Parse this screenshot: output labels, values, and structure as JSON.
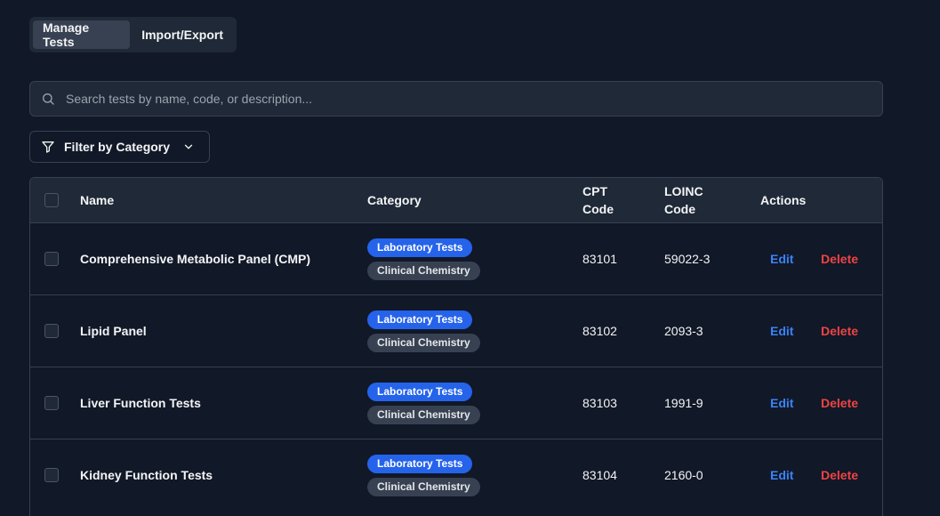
{
  "tabs": [
    {
      "label": "Manage Tests",
      "active": true
    },
    {
      "label": "Import/Export",
      "active": false
    }
  ],
  "search": {
    "placeholder": "Search tests by name, code, or description...",
    "icon": "search-icon"
  },
  "filter": {
    "label": "Filter by Category",
    "icon": "filter-icon"
  },
  "table": {
    "headers": {
      "name": "Name",
      "category": "Category",
      "cpt_line1": "CPT",
      "cpt_line2": "Code",
      "loinc_line1": "LOINC",
      "loinc_line2": "Code",
      "actions": "Actions"
    },
    "rows": [
      {
        "name": "Comprehensive Metabolic Panel (CMP)",
        "category": "Laboratory Tests",
        "subcategory": "Clinical Chemistry",
        "cpt": "83101",
        "loinc": "59022-3",
        "edit": "Edit",
        "delete": "Delete"
      },
      {
        "name": "Lipid Panel",
        "category": "Laboratory Tests",
        "subcategory": "Clinical Chemistry",
        "cpt": "83102",
        "loinc": "2093-3",
        "edit": "Edit",
        "delete": "Delete"
      },
      {
        "name": "Liver Function Tests",
        "category": "Laboratory Tests",
        "subcategory": "Clinical Chemistry",
        "cpt": "83103",
        "loinc": "1991-9",
        "edit": "Edit",
        "delete": "Delete"
      },
      {
        "name": "Kidney Function Tests",
        "category": "Laboratory Tests",
        "subcategory": "Clinical Chemistry",
        "cpt": "83104",
        "loinc": "2160-0",
        "edit": "Edit",
        "delete": "Delete"
      }
    ]
  },
  "colors": {
    "background": "#111827",
    "surface": "#1f2937",
    "border": "#374151",
    "primary": "#2563eb",
    "edit": "#3b82f6",
    "delete": "#ef4444"
  }
}
